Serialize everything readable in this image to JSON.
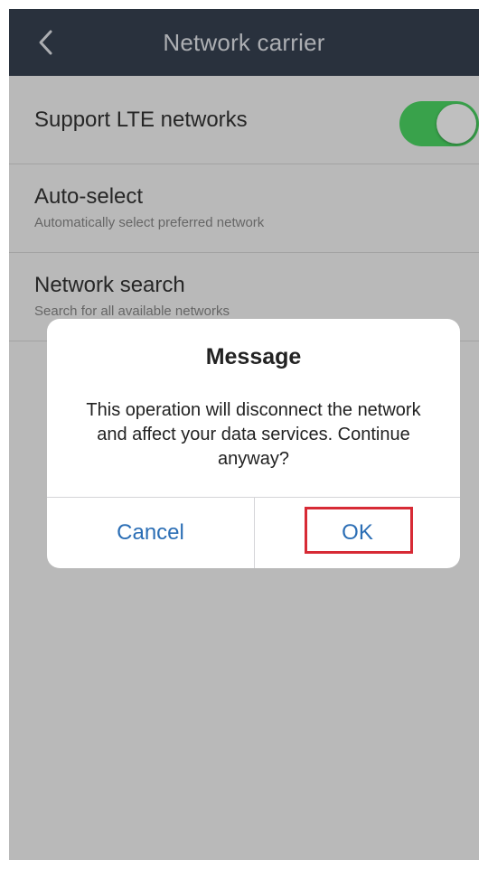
{
  "nav": {
    "title": "Network carrier",
    "back_icon": "chevron-left-icon"
  },
  "settings": {
    "lte": {
      "label": "Support LTE networks",
      "enabled": true
    },
    "auto_select": {
      "label": "Auto-select",
      "subtitle": "Automatically select preferred network"
    },
    "network_search": {
      "label": "Network search",
      "subtitle": "Search for all available networks"
    }
  },
  "dialog": {
    "title": "Message",
    "message": "This operation will disconnect the network and affect your data services. Continue anyway?",
    "cancel_label": "Cancel",
    "ok_label": "OK"
  },
  "colors": {
    "nav_background": "#374252",
    "toggle_on": "#4cd964",
    "button_text": "#2b6eb5",
    "highlight": "#d72a35"
  }
}
